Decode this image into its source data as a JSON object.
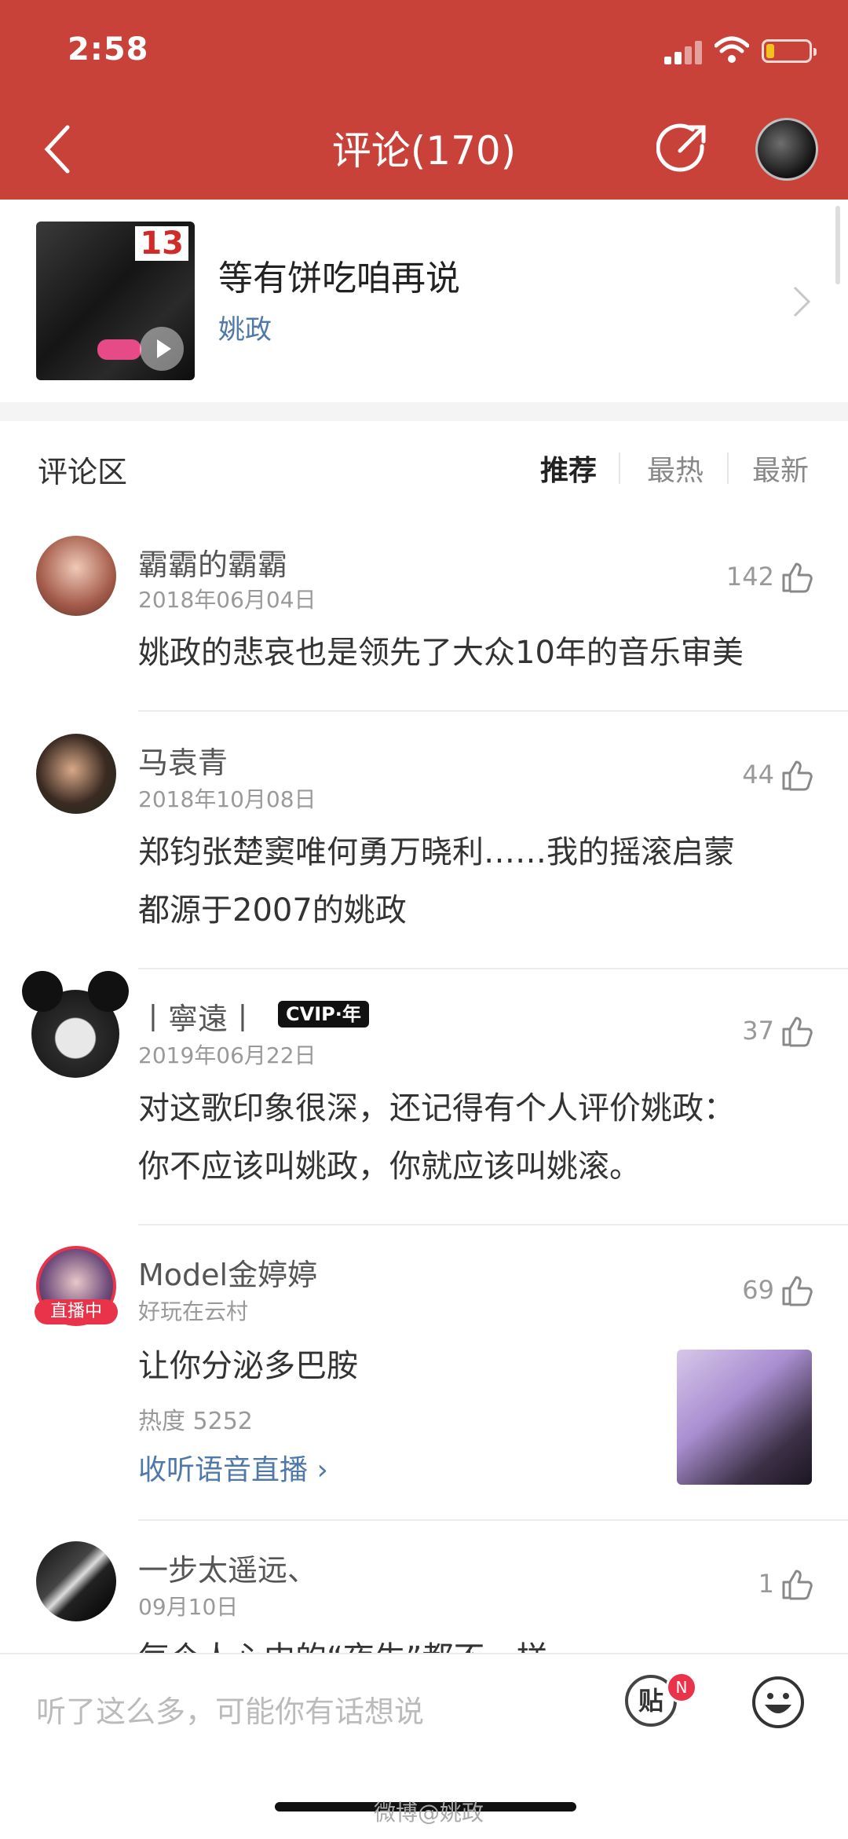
{
  "status_bar": {
    "time": "2:58"
  },
  "header": {
    "title": "评论(170)"
  },
  "song": {
    "name": "等有饼吃咱再说",
    "artist": "姚政",
    "cover_badge": "13"
  },
  "comments_section": {
    "title": "评论区",
    "sort_tabs": [
      "推荐",
      "最热",
      "最新"
    ],
    "active_sort": "推荐"
  },
  "comments": [
    {
      "name": "霸霸的霸霸",
      "date": "2018年06月04日",
      "likes": "142",
      "lines": [
        "姚政的悲哀也是领先了大众10年的音乐审美"
      ]
    },
    {
      "name": "马袁青",
      "date": "2018年10月08日",
      "likes": "44",
      "lines": [
        "郑钧张楚窦唯何勇万晓利……我的摇滚启蒙",
        "都源于2007的姚政"
      ]
    },
    {
      "name": "丨寧遠丨",
      "vip": "CVIP·年",
      "date": "2019年06月22日",
      "likes": "37",
      "lines": [
        "对这歌印象很深，还记得有个人评价姚政：",
        "你不应该叫姚政，你就应该叫姚滚。"
      ]
    },
    {
      "name": "Model金婷婷",
      "subtitle": "好玩在云村",
      "live_badge": "直播中",
      "likes": "69",
      "lines": [
        "让你分泌多巴胺"
      ],
      "hot": "热度 5252",
      "link": "收听语音直播 ›"
    },
    {
      "name": "一步太遥远、",
      "date": "09月10日",
      "likes": "1",
      "lines": [
        "每个人心中的“夜生”都不一样"
      ]
    }
  ],
  "bottom_bar": {
    "placeholder": "听了这么多，可能你有话想说",
    "tie_label": "贴",
    "tie_badge": "N",
    "watermark": "微博@姚政"
  },
  "colors": {
    "header": "#c9423a",
    "link": "#4e79a8",
    "badge": "#e8334a"
  }
}
